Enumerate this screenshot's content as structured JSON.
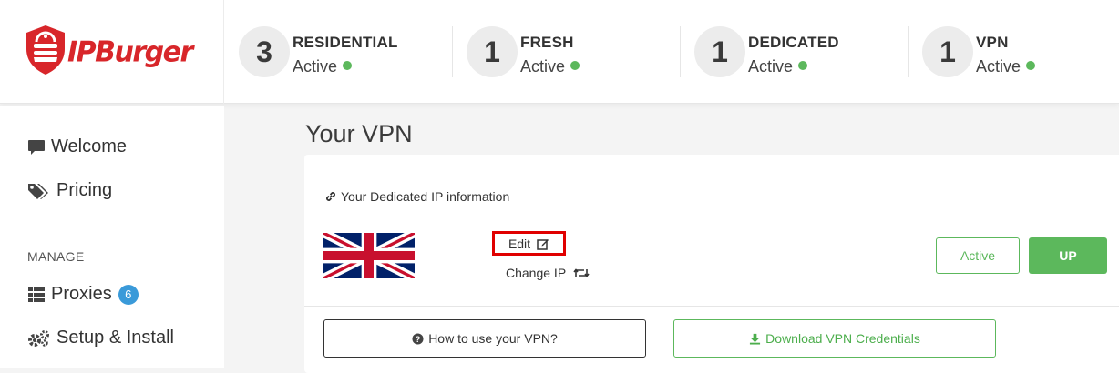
{
  "brand": {
    "logo_text": "IPBurger",
    "accent": "#d8262a"
  },
  "stats": [
    {
      "count": "3",
      "label": "RESIDENTIAL",
      "state": "Active"
    },
    {
      "count": "1",
      "label": "FRESH",
      "state": "Active"
    },
    {
      "count": "1",
      "label": "DEDICATED",
      "state": "Active"
    },
    {
      "count": "1",
      "label": "VPN",
      "state": "Active"
    }
  ],
  "sidebar": {
    "items": [
      {
        "label": "Welcome",
        "icon": "comment-icon"
      },
      {
        "label": "Pricing",
        "icon": "tags-icon"
      }
    ],
    "section_heading": "MANAGE",
    "manage_items": [
      {
        "label": "Proxies",
        "icon": "table-icon",
        "badge": "6"
      },
      {
        "label": "Setup & Install",
        "icon": "gears-icon"
      }
    ]
  },
  "main": {
    "title": "Your VPN",
    "info_title": "Your Dedicated IP information",
    "flag": "united-kingdom-flag",
    "edit_label": "Edit",
    "change_ip_label": "Change IP",
    "status_button": "Active",
    "up_button": "UP",
    "howto_button": "How to use your VPN?",
    "download_button": "Download VPN Credentials"
  },
  "colors": {
    "success": "#5cb85c",
    "badge": "#3a9ad9",
    "highlight": "#e00000"
  }
}
